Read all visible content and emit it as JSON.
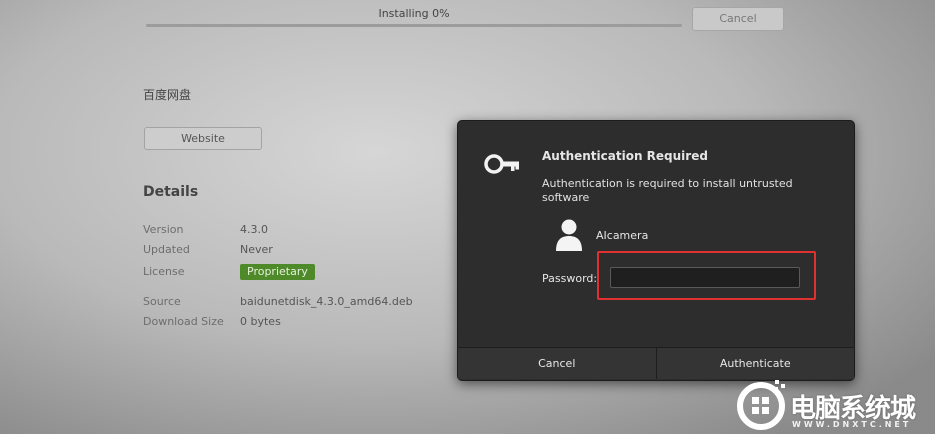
{
  "install": {
    "status": "Installing 0%",
    "progress": 0,
    "cancel_label": "Cancel"
  },
  "app": {
    "name": "百度网盘",
    "website_label": "Website"
  },
  "details": {
    "title": "Details",
    "rows": [
      {
        "label": "Version",
        "value": "4.3.0"
      },
      {
        "label": "Updated",
        "value": "Never"
      },
      {
        "label": "License",
        "value": "Proprietary"
      },
      {
        "label": "Source",
        "value": "baidunetdisk_4.3.0_amd64.deb"
      },
      {
        "label": "Download Size",
        "value": "0 bytes"
      }
    ]
  },
  "dialog": {
    "title": "Authentication Required",
    "message": "Authentication is required to install untrusted software",
    "user": "AIcamera",
    "password_label": "Password:",
    "password_value": "",
    "cancel_label": "Cancel",
    "authenticate_label": "Authenticate"
  },
  "icons": {
    "auth": "key-icon",
    "user": "user-avatar-icon"
  },
  "colors": {
    "license_badge": "#4e8a29",
    "highlight": "#e03131",
    "dialog_bg": "#2d2d2d"
  },
  "watermark": {
    "text": "电脑系统城",
    "sub": "WWW.DNXTC.NET"
  }
}
